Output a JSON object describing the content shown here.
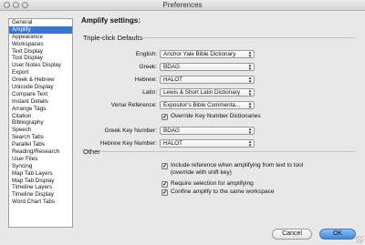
{
  "window": {
    "title": "Preferences"
  },
  "sidebar": {
    "items": [
      {
        "label": "General",
        "selected": false
      },
      {
        "label": "Amplify",
        "selected": true
      },
      {
        "label": "Appearance",
        "selected": false
      },
      {
        "label": "Workspaces",
        "selected": false
      },
      {
        "label": "Text Display",
        "selected": false
      },
      {
        "label": "Tool Display",
        "selected": false
      },
      {
        "label": "User Notes Display",
        "selected": false
      },
      {
        "label": "Export",
        "selected": false
      },
      {
        "label": "Greek & Hebrew",
        "selected": false
      },
      {
        "label": "Unicode Display",
        "selected": false
      },
      {
        "label": "Compare Text",
        "selected": false
      },
      {
        "label": "Instant Details",
        "selected": false
      },
      {
        "label": "Arrange Tags",
        "selected": false
      },
      {
        "label": "Citation",
        "selected": false
      },
      {
        "label": "Bibliography",
        "selected": false
      },
      {
        "label": "Speech",
        "selected": false
      },
      {
        "label": "Search Tabs",
        "selected": false
      },
      {
        "label": "Parallel Tabs",
        "selected": false
      },
      {
        "label": "Reading/Research",
        "selected": false
      },
      {
        "label": "User Files",
        "selected": false
      },
      {
        "label": "Syncing",
        "selected": false
      },
      {
        "label": "Map Tab Layers",
        "selected": false
      },
      {
        "label": "Map Tab Display",
        "selected": false
      },
      {
        "label": "Timeline Layers",
        "selected": false
      },
      {
        "label": "Timeline Display",
        "selected": false
      },
      {
        "label": "Word Chart Tabs",
        "selected": false
      }
    ]
  },
  "main": {
    "heading": "Amplify settings:",
    "triple_click": {
      "title": "Triple-click Defaults",
      "rows": [
        {
          "label": "English:",
          "value": "Anchor Yale Bible Dictionary"
        },
        {
          "label": "Greek:",
          "value": "BDAG"
        },
        {
          "label": "Hebrew:",
          "value": "HALOT"
        },
        {
          "label": "Latin:",
          "value": "Lewis & Short Latin Dictionary"
        },
        {
          "label": "Verse Reference:",
          "value": "Expositor's Bible Commenta..."
        }
      ],
      "override_checkbox": {
        "label": "Override Key Number Dictionaries",
        "checked": true
      },
      "key_rows": [
        {
          "label": "Greek Key Number:",
          "value": "BDAG"
        },
        {
          "label": "Hebrew Key Number:",
          "value": "HALOT"
        }
      ]
    },
    "other": {
      "title": "Other",
      "checkboxes": [
        {
          "label": "Include reference when amplifying from text to tool",
          "sublabel": "(override with shift key)",
          "checked": true
        },
        {
          "label": "Require selection for amplifying",
          "sublabel": "",
          "checked": true
        },
        {
          "label": "Confine amplify to the same workspace",
          "sublabel": "",
          "checked": true
        }
      ]
    }
  },
  "buttons": {
    "cancel": "Cancel",
    "ok": "OK"
  },
  "colors": {
    "selection": "#3875d7",
    "default_button": "#3d8ae0"
  }
}
